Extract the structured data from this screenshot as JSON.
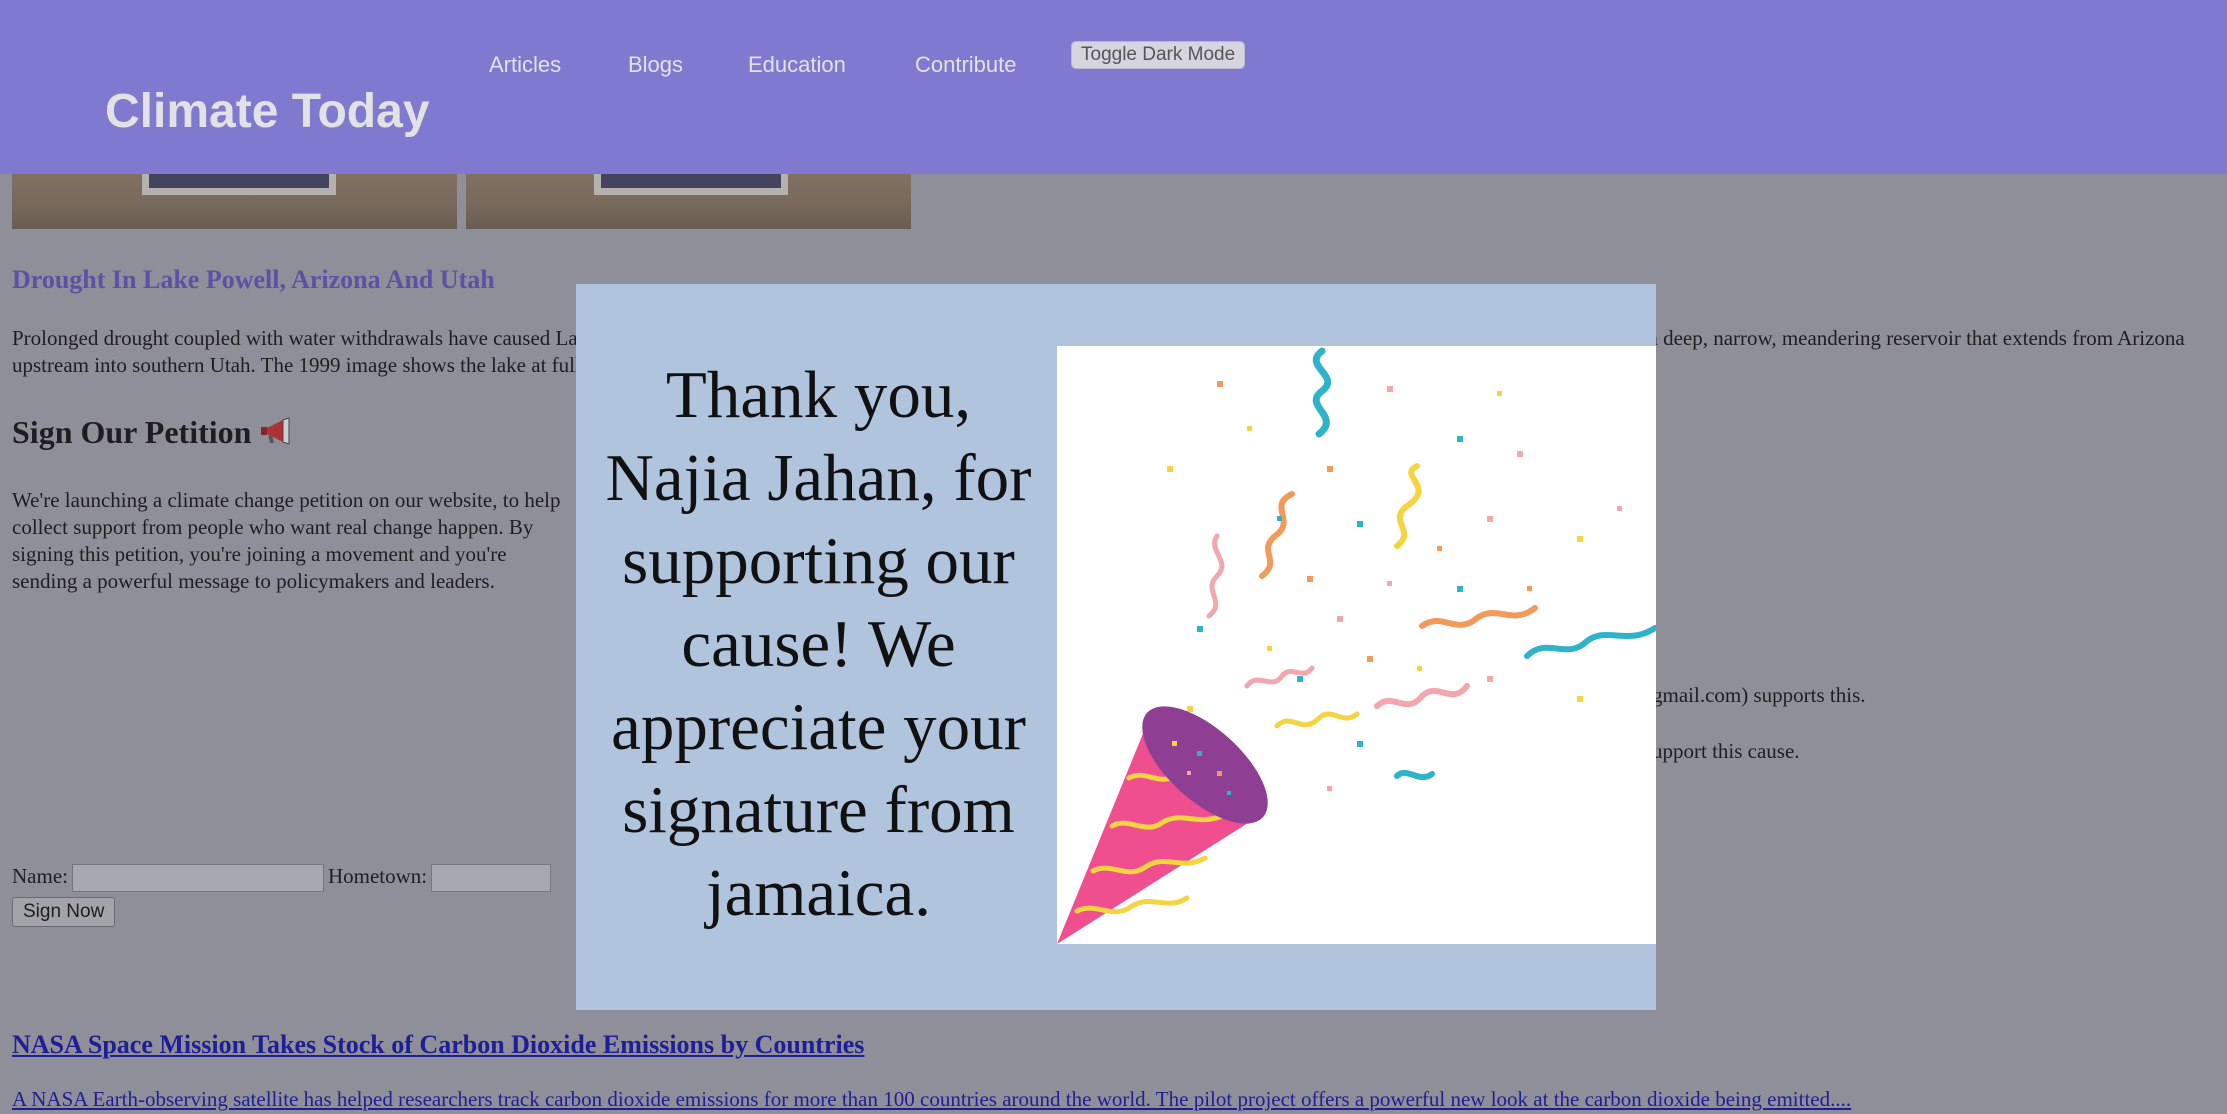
{
  "header": {
    "title": "Climate Today",
    "nav": [
      "Articles",
      "Blogs",
      "Education",
      "Contribute"
    ],
    "toggle_label": "Toggle Dark Mode"
  },
  "article": {
    "title": "Drought In Lake Powell, Arizona And Utah",
    "body": "Prolonged drought coupled with water withdrawals have caused Lake Powell to drop to historic lows. Lake Powell is a reservoir on the Colorado River. Although it looks like a lake, it is actually a deep, narrow, meandering reservoir that extends from Arizona upstream into southern Utah. The 1999 image shows the lake at full capacity while the 2014 image shows a dramatic decline."
  },
  "petition": {
    "title": "Sign Our Petition",
    "icon": "megaphone-icon",
    "body": "We're launching a climate change petition on our website, to help collect support from people who want real change happen. By signing this petition, you're joining a movement and you're sending a powerful message to policymakers and leaders.",
    "supporter_line": "gmail.com) supports this.",
    "support_count_line": "upport this cause.",
    "name_label": "Name:",
    "hometown_label": "Hometown:",
    "name_value": "",
    "hometown_value": "",
    "sign_label": "Sign Now"
  },
  "news": {
    "title": "NASA Space Mission Takes Stock of Carbon Dioxide Emissions by Countries",
    "description": "A NASA Earth-observing satellite has helped researchers track carbon dioxide emissions for more than 100 countries around the world. The pilot project offers a powerful new look at the carbon dioxide being emitted...."
  },
  "modal": {
    "message": "Thank you, Najia Jahan, for supporting our cause! We appreciate your signature from jamaica.",
    "image": "party-popper-confetti"
  },
  "colors": {
    "header_bg": "#877fe5",
    "modal_bg": "#b0c4de",
    "article_title": "#5c4fb0",
    "link": "#1010a0"
  }
}
